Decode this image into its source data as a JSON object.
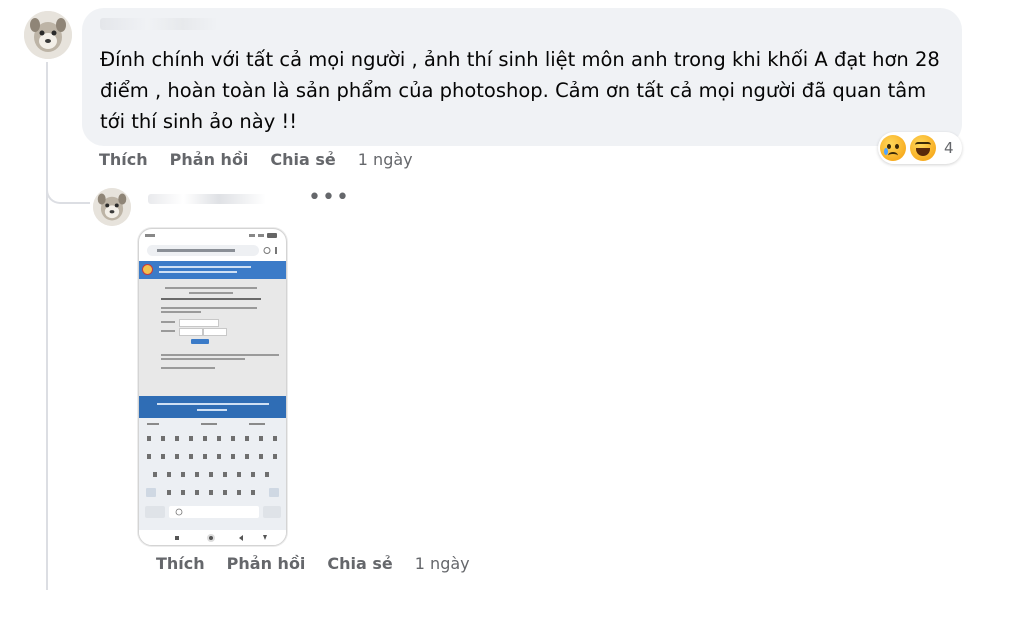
{
  "comment1": {
    "text": "Đính chính với tất cả mọi người , ảnh thí sinh liệt môn anh trong khi khối A đạt hơn 28 điểm , hoàn toàn là sản phẩm của photoshop. Cảm ơn tất cả mọi người đã quan tâm tới thí sinh ảo này !!",
    "reaction_count": "4",
    "reactions": [
      "sad-emoji",
      "haha-emoji"
    ],
    "actions": {
      "like": "Thích",
      "reply": "Phản hồi",
      "share": "Chia sẻ",
      "time": "1 ngày"
    }
  },
  "comment2": {
    "more": "•••",
    "actions": {
      "like": "Thích",
      "reply": "Phản hồi",
      "share": "Chia sẻ",
      "time": "1 ngày"
    }
  },
  "colors": {
    "bubble": "#f0f2f5",
    "secondary_text": "#65676b",
    "site_blue": "#3b7bc8"
  }
}
